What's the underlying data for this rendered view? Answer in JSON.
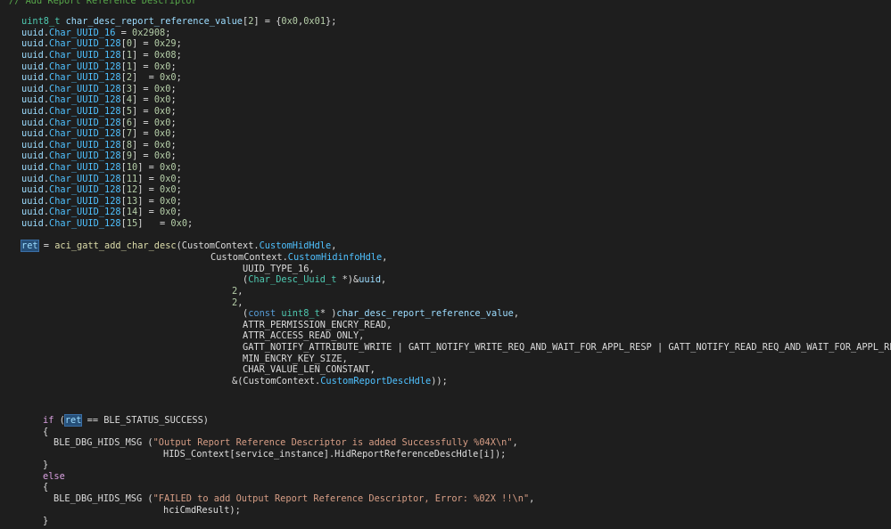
{
  "editor": {
    "lines": [
      [
        {
          "t": "// Add Report Reference Descriptor",
          "c": "comment"
        }
      ],
      [
        {
          "t": "uint8_t",
          "c": "type"
        },
        {
          "t": " ",
          "c": "plain"
        },
        {
          "t": "char_desc_report_reference_value",
          "c": "var"
        },
        {
          "t": "[",
          "c": "plain"
        },
        {
          "t": "2",
          "c": "num"
        },
        {
          "t": "] = {",
          "c": "plain"
        },
        {
          "t": "0x0",
          "c": "num"
        },
        {
          "t": ",",
          "c": "plain"
        },
        {
          "t": "0x01",
          "c": "num"
        },
        {
          "t": "};",
          "c": "plain"
        }
      ],
      [
        {
          "t": "uuid",
          "c": "var"
        },
        {
          "t": ".",
          "c": "plain"
        },
        {
          "t": "Char_UUID_16",
          "c": "field"
        },
        {
          "t": " = ",
          "c": "plain"
        },
        {
          "t": "0x2908",
          "c": "num"
        },
        {
          "t": ";",
          "c": "plain"
        }
      ],
      [
        {
          "t": "uuid",
          "c": "var"
        },
        {
          "t": ".",
          "c": "plain"
        },
        {
          "t": "Char_UUID_128",
          "c": "field"
        },
        {
          "t": "[",
          "c": "plain"
        },
        {
          "t": "0",
          "c": "num"
        },
        {
          "t": "] = ",
          "c": "plain"
        },
        {
          "t": "0x29",
          "c": "num"
        },
        {
          "t": ";",
          "c": "plain"
        }
      ],
      [
        {
          "t": "uuid",
          "c": "var"
        },
        {
          "t": ".",
          "c": "plain"
        },
        {
          "t": "Char_UUID_128",
          "c": "field"
        },
        {
          "t": "[",
          "c": "plain"
        },
        {
          "t": "1",
          "c": "num"
        },
        {
          "t": "] = ",
          "c": "plain"
        },
        {
          "t": "0x08",
          "c": "num"
        },
        {
          "t": ";",
          "c": "plain"
        }
      ],
      [
        {
          "t": "uuid",
          "c": "var"
        },
        {
          "t": ".",
          "c": "plain"
        },
        {
          "t": "Char_UUID_128",
          "c": "field"
        },
        {
          "t": "[",
          "c": "plain"
        },
        {
          "t": "1",
          "c": "num"
        },
        {
          "t": "] = ",
          "c": "plain"
        },
        {
          "t": "0x0",
          "c": "num"
        },
        {
          "t": ";",
          "c": "plain"
        }
      ],
      [
        {
          "t": "uuid",
          "c": "var"
        },
        {
          "t": ".",
          "c": "plain"
        },
        {
          "t": "Char_UUID_128",
          "c": "field"
        },
        {
          "t": "[",
          "c": "plain"
        },
        {
          "t": "2",
          "c": "num"
        },
        {
          "t": "]  = ",
          "c": "plain"
        },
        {
          "t": "0x0",
          "c": "num"
        },
        {
          "t": ";",
          "c": "plain"
        }
      ],
      [
        {
          "t": "uuid",
          "c": "var"
        },
        {
          "t": ".",
          "c": "plain"
        },
        {
          "t": "Char_UUID_128",
          "c": "field"
        },
        {
          "t": "[",
          "c": "plain"
        },
        {
          "t": "3",
          "c": "num"
        },
        {
          "t": "] = ",
          "c": "plain"
        },
        {
          "t": "0x0",
          "c": "num"
        },
        {
          "t": ";",
          "c": "plain"
        }
      ],
      [
        {
          "t": "uuid",
          "c": "var"
        },
        {
          "t": ".",
          "c": "plain"
        },
        {
          "t": "Char_UUID_128",
          "c": "field"
        },
        {
          "t": "[",
          "c": "plain"
        },
        {
          "t": "4",
          "c": "num"
        },
        {
          "t": "] = ",
          "c": "plain"
        },
        {
          "t": "0x0",
          "c": "num"
        },
        {
          "t": ";",
          "c": "plain"
        }
      ],
      [
        {
          "t": "uuid",
          "c": "var"
        },
        {
          "t": ".",
          "c": "plain"
        },
        {
          "t": "Char_UUID_128",
          "c": "field"
        },
        {
          "t": "[",
          "c": "plain"
        },
        {
          "t": "5",
          "c": "num"
        },
        {
          "t": "] = ",
          "c": "plain"
        },
        {
          "t": "0x0",
          "c": "num"
        },
        {
          "t": ";",
          "c": "plain"
        }
      ],
      [
        {
          "t": "uuid",
          "c": "var"
        },
        {
          "t": ".",
          "c": "plain"
        },
        {
          "t": "Char_UUID_128",
          "c": "field"
        },
        {
          "t": "[",
          "c": "plain"
        },
        {
          "t": "6",
          "c": "num"
        },
        {
          "t": "] = ",
          "c": "plain"
        },
        {
          "t": "0x0",
          "c": "num"
        },
        {
          "t": ";",
          "c": "plain"
        }
      ],
      [
        {
          "t": "uuid",
          "c": "var"
        },
        {
          "t": ".",
          "c": "plain"
        },
        {
          "t": "Char_UUID_128",
          "c": "field"
        },
        {
          "t": "[",
          "c": "plain"
        },
        {
          "t": "7",
          "c": "num"
        },
        {
          "t": "] = ",
          "c": "plain"
        },
        {
          "t": "0x0",
          "c": "num"
        },
        {
          "t": ";",
          "c": "plain"
        }
      ],
      [
        {
          "t": "uuid",
          "c": "var"
        },
        {
          "t": ".",
          "c": "plain"
        },
        {
          "t": "Char_UUID_128",
          "c": "field"
        },
        {
          "t": "[",
          "c": "plain"
        },
        {
          "t": "8",
          "c": "num"
        },
        {
          "t": "] = ",
          "c": "plain"
        },
        {
          "t": "0x0",
          "c": "num"
        },
        {
          "t": ";",
          "c": "plain"
        }
      ],
      [
        {
          "t": "uuid",
          "c": "var"
        },
        {
          "t": ".",
          "c": "plain"
        },
        {
          "t": "Char_UUID_128",
          "c": "field"
        },
        {
          "t": "[",
          "c": "plain"
        },
        {
          "t": "9",
          "c": "num"
        },
        {
          "t": "] = ",
          "c": "plain"
        },
        {
          "t": "0x0",
          "c": "num"
        },
        {
          "t": ";",
          "c": "plain"
        }
      ],
      [
        {
          "t": "uuid",
          "c": "var"
        },
        {
          "t": ".",
          "c": "plain"
        },
        {
          "t": "Char_UUID_128",
          "c": "field"
        },
        {
          "t": "[",
          "c": "plain"
        },
        {
          "t": "10",
          "c": "num"
        },
        {
          "t": "] = ",
          "c": "plain"
        },
        {
          "t": "0x0",
          "c": "num"
        },
        {
          "t": ";",
          "c": "plain"
        }
      ],
      [
        {
          "t": "uuid",
          "c": "var"
        },
        {
          "t": ".",
          "c": "plain"
        },
        {
          "t": "Char_UUID_128",
          "c": "field"
        },
        {
          "t": "[",
          "c": "plain"
        },
        {
          "t": "11",
          "c": "num"
        },
        {
          "t": "] = ",
          "c": "plain"
        },
        {
          "t": "0x0",
          "c": "num"
        },
        {
          "t": ";",
          "c": "plain"
        }
      ],
      [
        {
          "t": "uuid",
          "c": "var"
        },
        {
          "t": ".",
          "c": "plain"
        },
        {
          "t": "Char_UUID_128",
          "c": "field"
        },
        {
          "t": "[",
          "c": "plain"
        },
        {
          "t": "12",
          "c": "num"
        },
        {
          "t": "] = ",
          "c": "plain"
        },
        {
          "t": "0x0",
          "c": "num"
        },
        {
          "t": ";",
          "c": "plain"
        }
      ],
      [
        {
          "t": "uuid",
          "c": "var"
        },
        {
          "t": ".",
          "c": "plain"
        },
        {
          "t": "Char_UUID_128",
          "c": "field"
        },
        {
          "t": "[",
          "c": "plain"
        },
        {
          "t": "13",
          "c": "num"
        },
        {
          "t": "] = ",
          "c": "plain"
        },
        {
          "t": "0x0",
          "c": "num"
        },
        {
          "t": ";",
          "c": "plain"
        }
      ],
      [
        {
          "t": "uuid",
          "c": "var"
        },
        {
          "t": ".",
          "c": "plain"
        },
        {
          "t": "Char_UUID_128",
          "c": "field"
        },
        {
          "t": "[",
          "c": "plain"
        },
        {
          "t": "14",
          "c": "num"
        },
        {
          "t": "] = ",
          "c": "plain"
        },
        {
          "t": "0x0",
          "c": "num"
        },
        {
          "t": ";",
          "c": "plain"
        }
      ],
      [
        {
          "t": "uuid",
          "c": "var"
        },
        {
          "t": ".",
          "c": "plain"
        },
        {
          "t": "Char_UUID_128",
          "c": "field"
        },
        {
          "t": "[",
          "c": "plain"
        },
        {
          "t": "15",
          "c": "num"
        },
        {
          "t": "]   = ",
          "c": "plain"
        },
        {
          "t": "0x0",
          "c": "num"
        },
        {
          "t": ";",
          "c": "plain"
        }
      ],
      [],
      [
        {
          "t": "ret",
          "c": "var",
          "hl": true
        },
        {
          "t": " = ",
          "c": "plain"
        },
        {
          "t": "aci_gatt_add_char_desc",
          "c": "fn"
        },
        {
          "t": "(CustomContext.",
          "c": "plain"
        },
        {
          "t": "CustomHidHdle",
          "c": "field"
        },
        {
          "t": ",",
          "c": "plain"
        }
      ],
      [
        {
          "t": "CustomContext.",
          "c": "plain"
        },
        {
          "t": "CustomHidinfoHdle",
          "c": "field"
        },
        {
          "t": ",",
          "c": "plain"
        }
      ],
      [
        {
          "t": "UUID_TYPE_16,",
          "c": "plain"
        }
      ],
      [
        {
          "t": "(",
          "c": "plain"
        },
        {
          "t": "Char_Desc_Uuid_t",
          "c": "type"
        },
        {
          "t": " *)&",
          "c": "plain"
        },
        {
          "t": "uuid",
          "c": "var"
        },
        {
          "t": ",",
          "c": "plain"
        }
      ],
      [
        {
          "t": "2",
          "c": "num"
        },
        {
          "t": ",",
          "c": "plain"
        }
      ],
      [
        {
          "t": "2",
          "c": "num"
        },
        {
          "t": ",",
          "c": "plain"
        }
      ],
      [
        {
          "t": "(",
          "c": "plain"
        },
        {
          "t": "const",
          "c": "kw"
        },
        {
          "t": " ",
          "c": "plain"
        },
        {
          "t": "uint8_t",
          "c": "type"
        },
        {
          "t": "* )",
          "c": "plain"
        },
        {
          "t": "char_desc_report_reference_value",
          "c": "var"
        },
        {
          "t": ",",
          "c": "plain"
        }
      ],
      [
        {
          "t": "ATTR_PERMISSION_ENCRY_READ,",
          "c": "plain"
        }
      ],
      [
        {
          "t": "ATTR_ACCESS_READ_ONLY,",
          "c": "plain"
        }
      ],
      [
        {
          "t": "GATT_NOTIFY_ATTRIBUTE_WRITE | GATT_NOTIFY_WRITE_REQ_AND_WAIT_FOR_APPL_RESP | GATT_NOTIFY_READ_REQ_AND_WAIT_FOR_APPL_RESP,",
          "c": "plain"
        }
      ],
      [
        {
          "t": "MIN_ENCRY_KEY_SIZE,",
          "c": "plain"
        }
      ],
      [
        {
          "t": "CHAR_VALUE_LEN_CONSTANT,",
          "c": "plain"
        }
      ],
      [
        {
          "t": "&(CustomContext.",
          "c": "plain"
        },
        {
          "t": "CustomReportDescHdle",
          "c": "field"
        },
        {
          "t": "));",
          "c": "plain"
        }
      ],
      [],
      [],
      [],
      [
        {
          "t": "if",
          "c": "flow"
        },
        {
          "t": " (",
          "c": "plain"
        },
        {
          "t": "ret",
          "c": "var",
          "hl": true
        },
        {
          "t": " == BLE_STATUS_SUCCESS)",
          "c": "plain"
        }
      ],
      [
        {
          "t": "{",
          "c": "plain"
        }
      ],
      [
        {
          "t": "BLE_DBG_HIDS_MSG (",
          "c": "plain"
        },
        {
          "t": "\"Output Report Reference Descriptor is added Successfully %04X\\n\"",
          "c": "str"
        },
        {
          "t": ",",
          "c": "plain"
        }
      ],
      [
        {
          "t": "HIDS_Context[service_instance].HidReportReferenceDescHdle[i]);",
          "c": "plain"
        }
      ],
      [
        {
          "t": "}",
          "c": "plain"
        }
      ],
      [
        {
          "t": "else",
          "c": "flow"
        }
      ],
      [
        {
          "t": "{",
          "c": "plain"
        }
      ],
      [
        {
          "t": "BLE_DBG_HIDS_MSG (",
          "c": "plain"
        },
        {
          "t": "\"FAILED to add Output Report Reference Descriptor, Error: %02X !!\\n\"",
          "c": "str"
        },
        {
          "t": ",",
          "c": "plain"
        }
      ],
      [
        {
          "t": "hciCmdResult);",
          "c": "plain"
        }
      ],
      [
        {
          "t": "}",
          "c": "plain"
        }
      ]
    ]
  }
}
